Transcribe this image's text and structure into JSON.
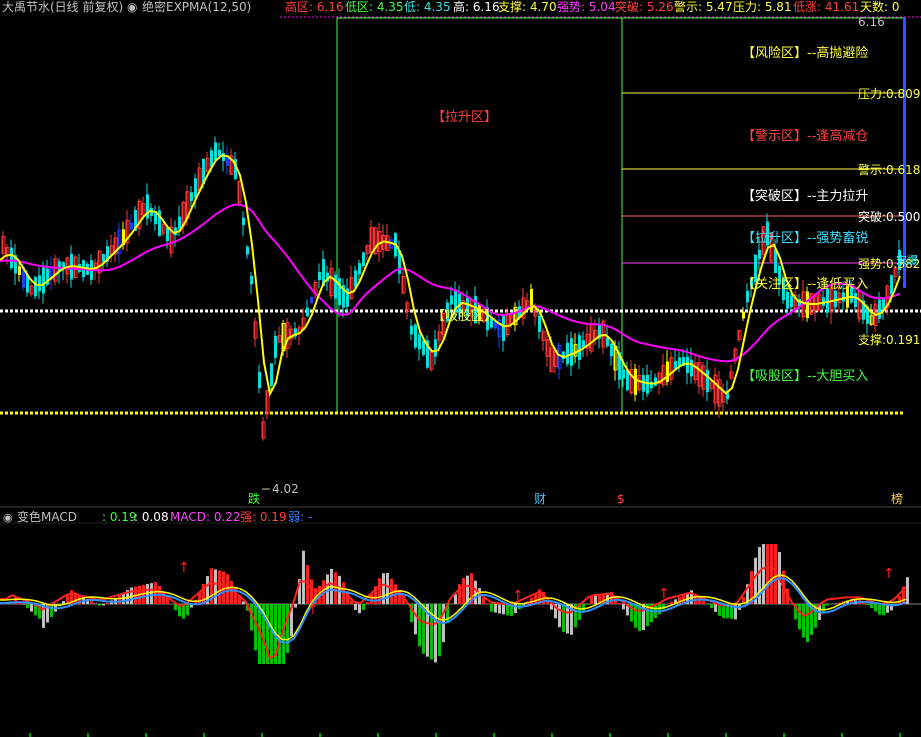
{
  "header": {
    "stock": "大禹节水(日线 前复权)",
    "indicator": "绝密EXPMA(12,50)",
    "gao_qu": "高区: 6.16",
    "di_qu": "低区: 4.35",
    "di": "低: 4.35",
    "gao": "高: 6.16",
    "zhi_cheng": "支撑: 4.70",
    "qiang_shi": "强势: 5.04",
    "tu_po": "突破: 5.26",
    "jing_shi": "警示: 5.47",
    "ya_li": "压力: 5.81",
    "di_zhang": "低涨: 41.61",
    "tian_shu": "天数: 0"
  },
  "macd_header": {
    "title": "变色MACD",
    "v1": ": 0.19",
    "v2": ": 0.08",
    "macd": "MACD: 0.22",
    "qiang": "强: 0.19",
    "ruo": "弱: -"
  },
  "zone_labels": {
    "fengxian": "【风险区】--高抛避险",
    "jingshi": "【警示区】--逢高减仓",
    "tupo": "【突破区】--主力拉升",
    "lasheng": "【拉升区】--强势畜锐",
    "guanzhu": "【关注区】--逢低买入",
    "xiguqu": "【吸股区】--大胆买入",
    "lasheng_main": "【拉升区】",
    "xigu_main": "【吸股区】"
  },
  "level_labels": {
    "high": "6.16",
    "yali": "压力:0.809",
    "jingshi": "警示:0.618",
    "tupo": "突破:0.500",
    "qiangshi": "强势:0.382",
    "zhicheng": "支撑:0.191",
    "low_marker": "4.02",
    "right_tag": "宋爆"
  },
  "markers": {
    "die": "跌",
    "cai": "财",
    "s": "$",
    "bang": "榜"
  },
  "colors": {
    "up": "#ff3232",
    "down": "#00e0e0",
    "blue": "#2040ff",
    "yellow_bar": "#ffff00",
    "ema_short": "#ffff00",
    "ema_long": "#ff00ff",
    "grid": "#ffffff",
    "macd_red": "#ff2020",
    "macd_green": "#00c000",
    "macd_gray": "#c0c0c0"
  },
  "chart_data": {
    "type": "candlestick",
    "price_range": [
      4.02,
      6.16
    ],
    "levels": {
      "high": 6.16,
      "low": 4.35,
      "yali": 5.81,
      "jingshi": 5.47,
      "tupo": 5.26,
      "qiangshi": 5.04,
      "zhicheng": 4.7
    },
    "macd_values": {
      "diff": 0.19,
      "dea": 0.08,
      "macd": 0.22
    }
  }
}
